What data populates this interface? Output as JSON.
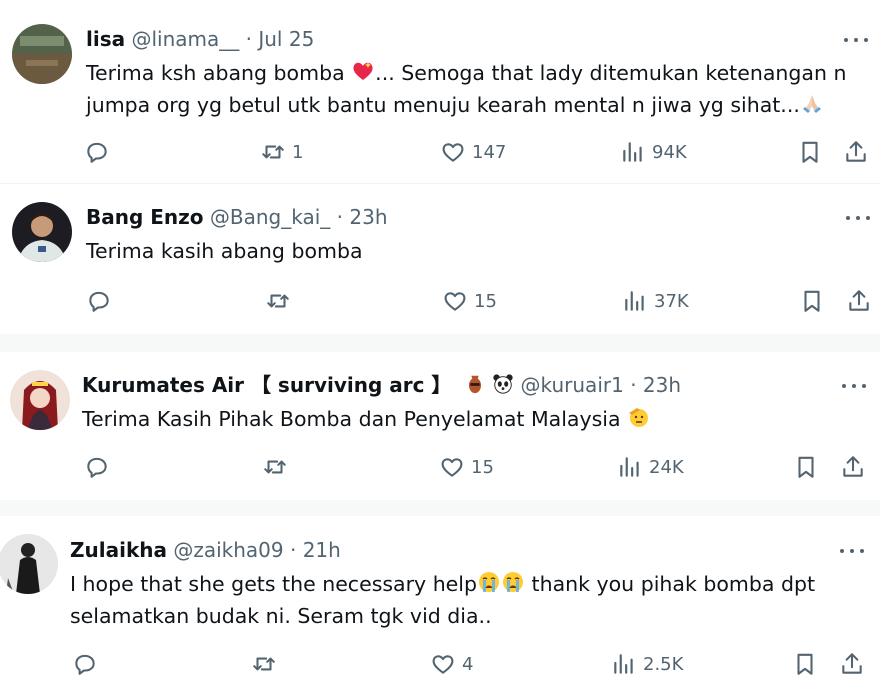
{
  "tweets": [
    {
      "name": "lisa",
      "handle": "@linama__",
      "time": "Jul 25",
      "text_line1_a": "Terima ksh abang bomba ",
      "text_line1_b": "... Semoga that lady ditemukan ketenangan n",
      "text_line2": "jumpa org yg betul utk bantu menuju kearah mental n jiwa yg sihat...",
      "replies": "",
      "reposts": "1",
      "likes": "147",
      "views": "94K"
    },
    {
      "name": "Bang Enzo",
      "handle": "@Bang_kai_",
      "time": "23h",
      "text_line1": "Terima kasih abang bomba",
      "replies": "",
      "reposts": "",
      "likes": "15",
      "views": "37K"
    },
    {
      "name": "Kurumates Air 【 surviving arc 】",
      "handle": "@kuruair1",
      "time": "23h",
      "text_line1": "Terima Kasih Pihak Bomba dan Penyelamat Malaysia ",
      "replies": "",
      "reposts": "",
      "likes": "15",
      "views": "24K"
    },
    {
      "name": "Zulaikha",
      "handle": "@zaikha09",
      "time": "21h",
      "text_line1_a": "I hope that she gets the necessary help",
      "text_line1_b": " thank you pihak bomba dpt",
      "text_line2": "selamatkan budak ni. Seram tgk vid dia..",
      "replies": "",
      "reposts": "",
      "likes": "4",
      "views": "2.5K"
    }
  ],
  "separator": "·",
  "icons": [
    "reply-icon",
    "repost-icon",
    "like-icon",
    "views-icon",
    "bookmark-icon",
    "share-icon",
    "more-icon"
  ],
  "colors": {
    "text": "#0f1419",
    "muted": "#536471",
    "divider": "#eff3f4"
  }
}
